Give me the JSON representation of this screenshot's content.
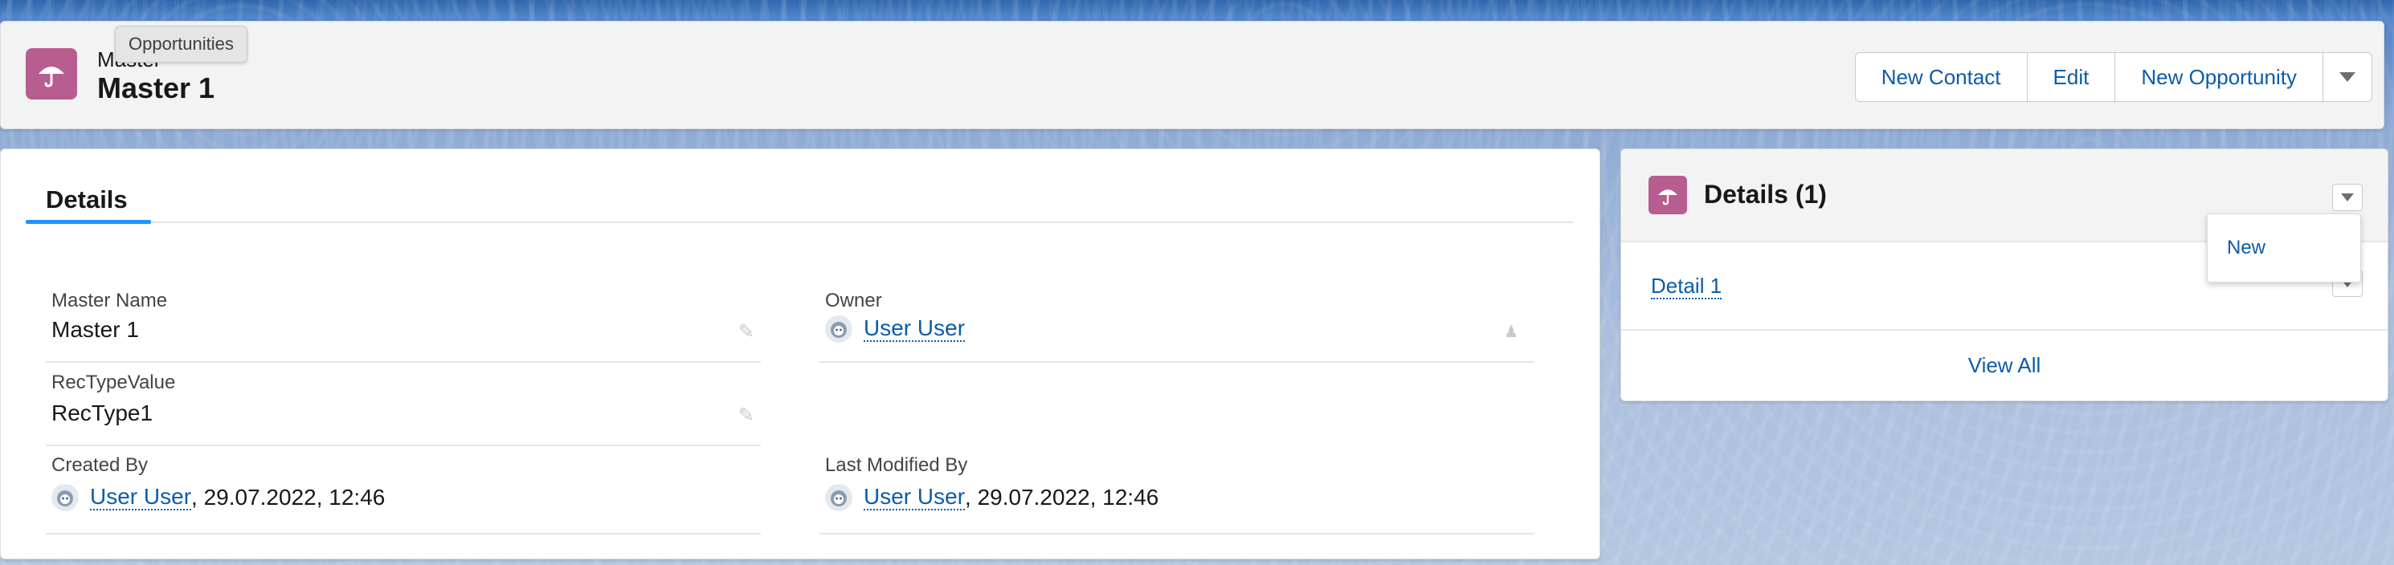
{
  "header": {
    "subtitle": "Master",
    "title": "Master 1",
    "tooltip": "Opportunities",
    "buttons": [
      "New Contact",
      "Edit",
      "New Opportunity"
    ]
  },
  "details": {
    "tab": "Details",
    "fields": {
      "master_name": {
        "label": "Master Name",
        "value": "Master 1"
      },
      "owner": {
        "label": "Owner",
        "value": "User User"
      },
      "rec_type": {
        "label": "RecTypeValue",
        "value": "RecType1"
      },
      "created_by": {
        "label": "Created By",
        "user": "User User",
        "date": ", 29.07.2022, 12:46"
      },
      "last_modified_by": {
        "label": "Last Modified By",
        "user": "User User",
        "date": ", 29.07.2022, 12:46"
      }
    }
  },
  "related": {
    "title": "Details (1)",
    "row_label": "Detail 1",
    "view_all": "View All",
    "menu_item": "New"
  },
  "colors": {
    "brand_icon": "#b85d8f",
    "link": "#0b5cab",
    "tab_accent": "#1b96ff"
  },
  "icons": {
    "object": "umbrella-icon",
    "edit": "pencil-icon",
    "change_owner": "change-owner-icon",
    "avatar": "user-avatar-icon"
  }
}
